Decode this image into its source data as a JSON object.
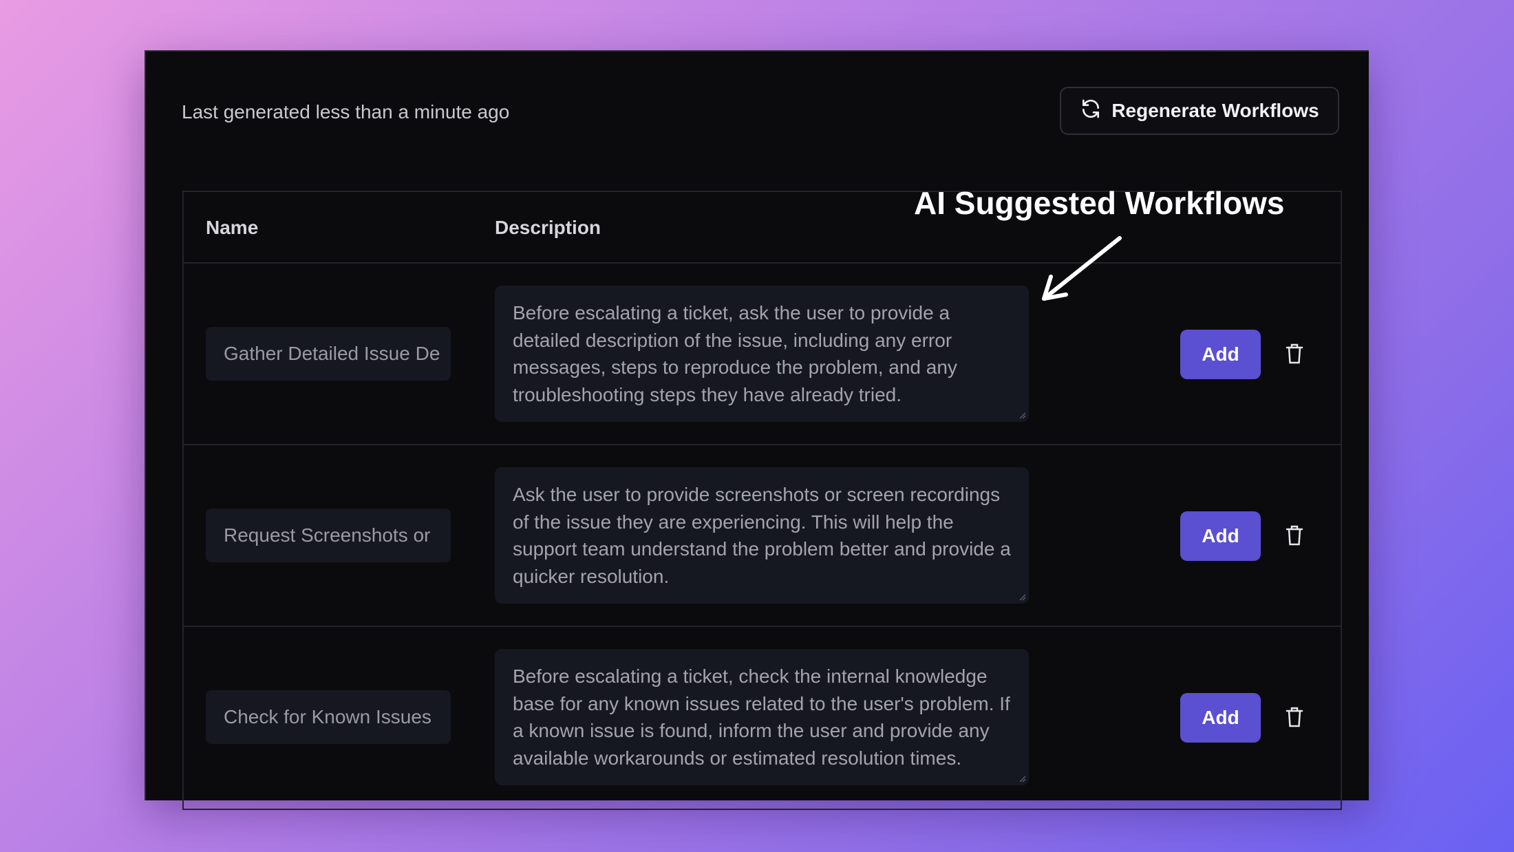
{
  "header": {
    "last_generated": "Last generated less than a minute ago",
    "regenerate_label": "Regenerate Workflows"
  },
  "table": {
    "columns": {
      "name": "Name",
      "description": "Description"
    },
    "rows": [
      {
        "name": "Gather Detailed Issue De",
        "description": "Before escalating a ticket, ask the user to provide a detailed description of the issue, including any error messages, steps to reproduce the problem, and any troubleshooting steps they have already tried.",
        "add_label": "Add"
      },
      {
        "name": "Request Screenshots or",
        "description": "Ask the user to provide screenshots or screen recordings of the issue they are experiencing. This will help the support team understand the problem better and provide a quicker resolution.",
        "add_label": "Add"
      },
      {
        "name": "Check for Known Issues",
        "description": "Before escalating a ticket, check the internal knowledge base for any known issues related to the user's problem. If a known issue is found, inform the user and provide any available workarounds or estimated resolution times.",
        "add_label": "Add"
      }
    ]
  },
  "annotation": {
    "text": "AI Suggested Workflows"
  },
  "colors": {
    "accent": "#5b4fd2",
    "background": "#0b0b0e",
    "input_bg": "#161821"
  },
  "icons": {
    "regenerate": "refresh-icon",
    "delete": "trash-icon",
    "annotation_arrow": "arrow-icon"
  }
}
